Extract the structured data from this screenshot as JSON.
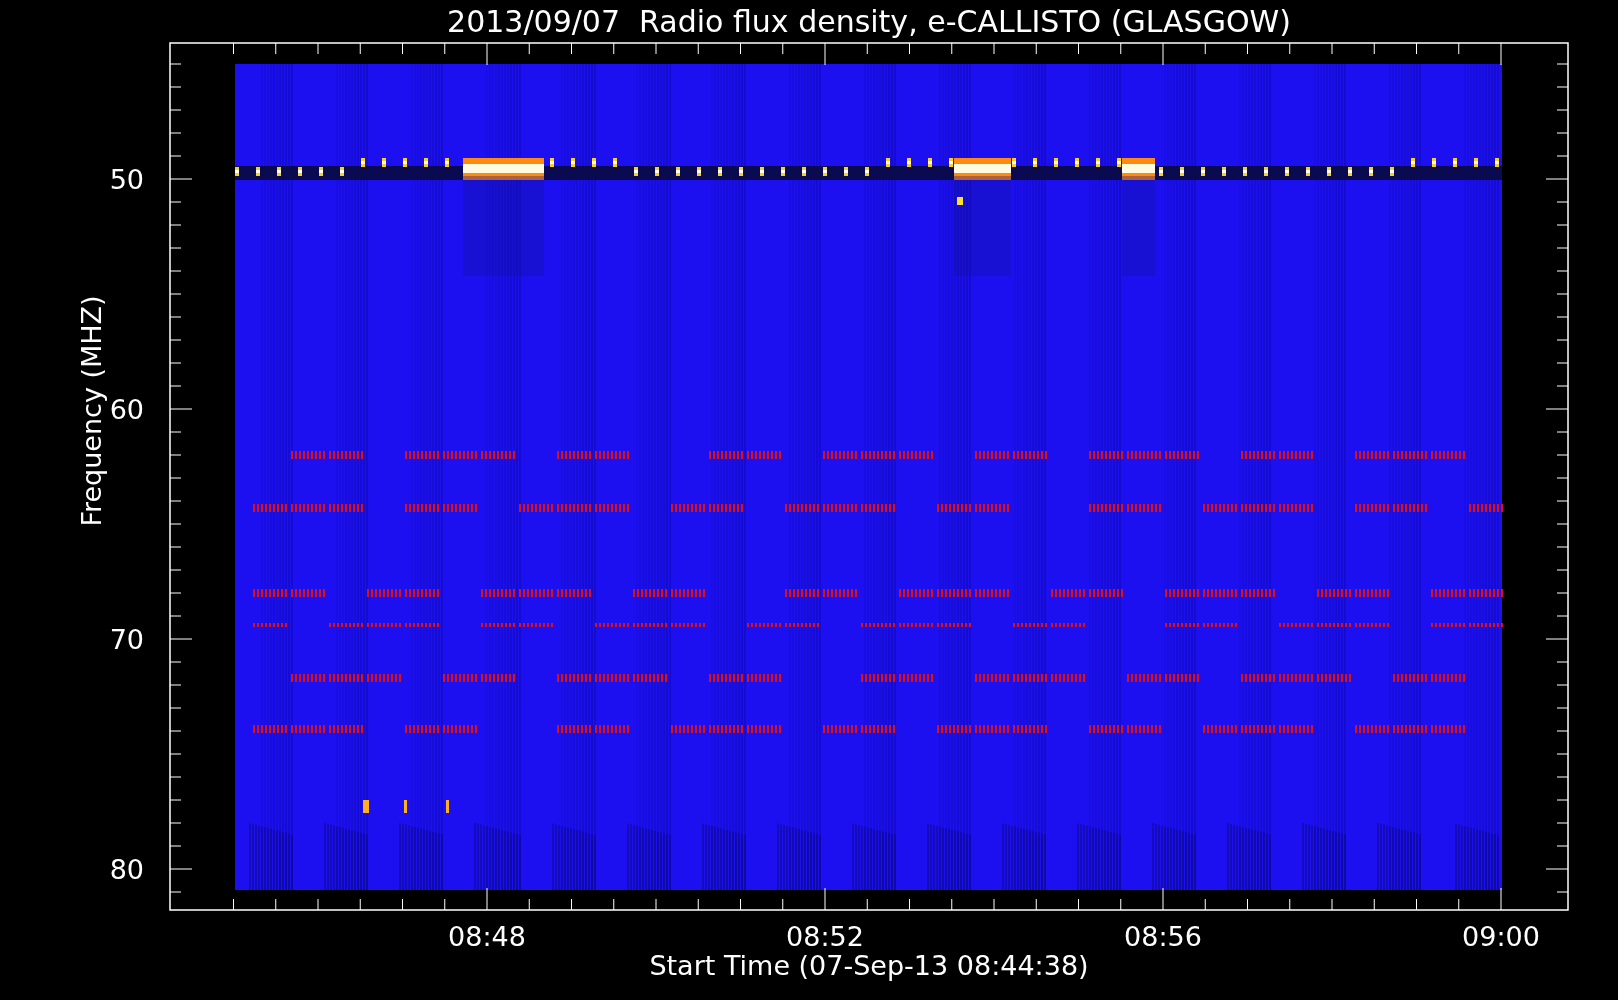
{
  "title": "2013/09/07  Radio flux density, e-CALLISTO (GLASGOW)",
  "y_axis": {
    "label": "Frequency (MHZ)",
    "ticks": [
      "50",
      "60",
      "70",
      "80"
    ]
  },
  "x_axis": {
    "label": "Start Time (07-Sep-13 08:44:38)",
    "ticks": [
      "08:48",
      "08:52",
      "08:56",
      "09:00"
    ]
  }
}
